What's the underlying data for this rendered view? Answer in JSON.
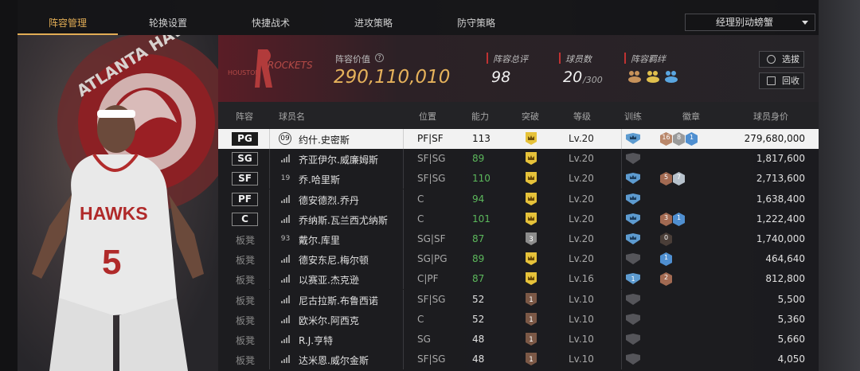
{
  "tabs": [
    "阵容管理",
    "轮换设置",
    "快捷战术",
    "进攻策略",
    "防守策略"
  ],
  "dropdown": {
    "value": "经理别动螃蟹"
  },
  "hero": {
    "logo_text": "ATLANTA HAWKS",
    "jersey_text": "HAWKS",
    "jersey_number": "5"
  },
  "team": {
    "logo_text": "HOUSTON",
    "logo_subtext": "ROCKETS"
  },
  "summary": {
    "value_label": "阵容价值",
    "value": "290,110,010",
    "rating_label": "阵容总评",
    "rating": "98",
    "players_label": "球员数",
    "players": "20",
    "players_max": "/300",
    "bond_label": "阵容羁绊"
  },
  "buttons": {
    "select": "选拔",
    "recycle": "回收"
  },
  "headers": {
    "lineup": "阵容",
    "name": "球员名",
    "position": "位置",
    "ability": "能力",
    "breakthrough": "突破",
    "level": "等级",
    "training": "训练",
    "badge": "徽章",
    "value": "球员身价"
  },
  "players": [
    {
      "slot": "PG",
      "jersey": "09",
      "name": "约什.史密斯",
      "position": "PF|SF",
      "ability": "113",
      "break": "crown",
      "level": "Lv.20",
      "train": "crown",
      "badges": [
        "16",
        "8",
        "1"
      ],
      "price": "279,680,000",
      "selected": true
    },
    {
      "slot": "SG",
      "jersey": "",
      "name": "齐亚伊尔.威廉姆斯",
      "position": "SF|SG",
      "ability": "89",
      "break": "crown",
      "level": "Lv.20",
      "train": "empty",
      "badges": [],
      "price": "1,817,600"
    },
    {
      "slot": "SF",
      "jersey": "19",
      "name": "乔.哈里斯",
      "position": "SF|SG",
      "ability": "110",
      "break": "crown",
      "level": "Lv.20",
      "train": "crown",
      "badges": [
        "5",
        "7"
      ],
      "price": "2,713,600"
    },
    {
      "slot": "PF",
      "jersey": "",
      "name": "德安德烈.乔丹",
      "position": "C",
      "ability": "94",
      "break": "crown",
      "level": "Lv.20",
      "train": "crown",
      "badges": [],
      "price": "1,638,400"
    },
    {
      "slot": "C",
      "jersey": "",
      "name": "乔纳斯.瓦兰西尤纳斯",
      "position": "C",
      "ability": "101",
      "break": "crown",
      "level": "Lv.20",
      "train": "crown",
      "badges": [
        "3",
        "1"
      ],
      "price": "1,222,400"
    },
    {
      "slot": "板凳",
      "jersey": "93",
      "name": "戴尔.库里",
      "position": "SG|SF",
      "ability": "87",
      "break": "3",
      "level": "Lv.20",
      "train": "crown",
      "badges": [
        "0"
      ],
      "price": "1,740,000"
    },
    {
      "slot": "板凳",
      "jersey": "",
      "name": "德安东尼.梅尔顿",
      "position": "SG|PG",
      "ability": "89",
      "break": "crown",
      "level": "Lv.20",
      "train": "empty",
      "badges": [
        "1"
      ],
      "price": "464,640"
    },
    {
      "slot": "板凳",
      "jersey": "",
      "name": "以赛亚.杰克逊",
      "position": "C|PF",
      "ability": "87",
      "break": "crown",
      "level": "Lv.16",
      "train": "1",
      "badges": [
        "2"
      ],
      "price": "812,800"
    },
    {
      "slot": "板凳",
      "jersey": "",
      "name": "尼古拉斯.布鲁西诺",
      "position": "SF|SG",
      "ability": "52",
      "break": "1",
      "level": "Lv.10",
      "train": "empty",
      "badges": [],
      "price": "5,500"
    },
    {
      "slot": "板凳",
      "jersey": "",
      "name": "欧米尔.阿西克",
      "position": "C",
      "ability": "52",
      "break": "1",
      "level": "Lv.10",
      "train": "empty",
      "badges": [],
      "price": "5,360"
    },
    {
      "slot": "板凳",
      "jersey": "",
      "name": "R.J.亨特",
      "position": "SG",
      "ability": "48",
      "break": "1",
      "level": "Lv.10",
      "train": "empty",
      "badges": [],
      "price": "5,660"
    },
    {
      "slot": "板凳",
      "jersey": "",
      "name": "达米恩.威尔金斯",
      "position": "SF|SG",
      "ability": "48",
      "break": "1",
      "level": "Lv.10",
      "train": "empty",
      "badges": [],
      "price": "4,050"
    }
  ],
  "colors": {
    "accent": "#e2ad55",
    "green": "#5cb85c",
    "red": "#c03232"
  }
}
